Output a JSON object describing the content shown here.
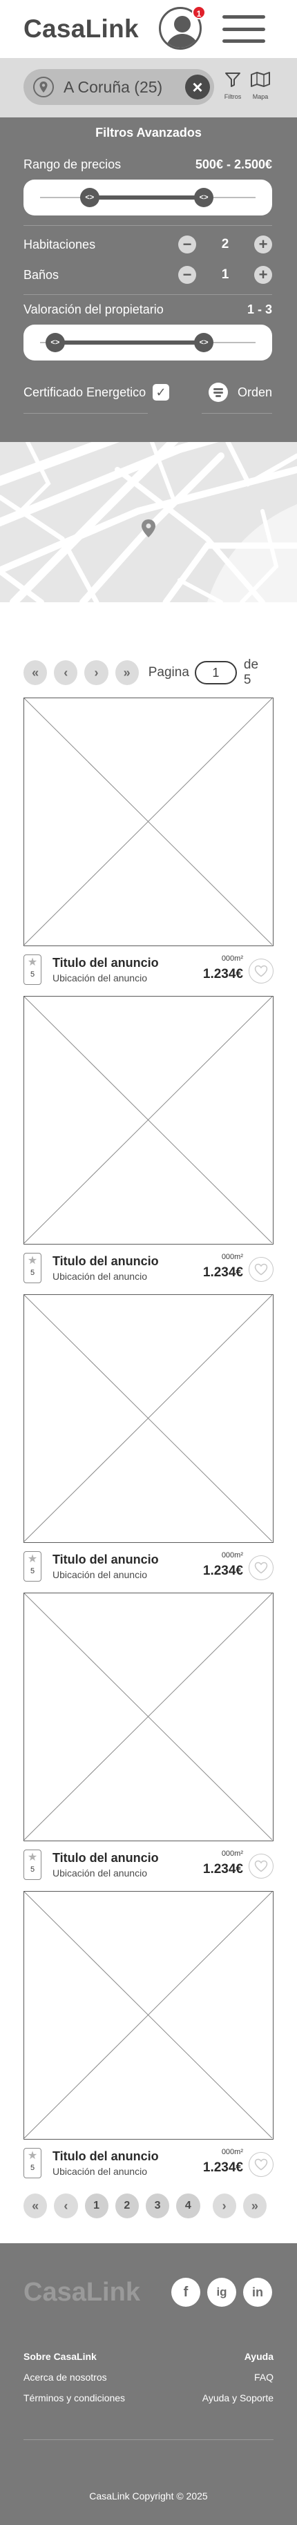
{
  "header": {
    "logo": "CasaLink",
    "notification_count": "1"
  },
  "search": {
    "location": "A Coruña (25)",
    "clear_label": "×",
    "filters_label": "Filtros",
    "map_label": "Mapa"
  },
  "filters": {
    "title": "Filtros Avanzados",
    "price_label": "Rango de precios",
    "price_value": "500€ - 2.500€",
    "price_range_fraction": [
      0.23,
      0.76
    ],
    "rooms_label": "Habitaciones",
    "rooms_value": "2",
    "baths_label": "Baños",
    "baths_value": "1",
    "rating_label": "Valoración del propietario",
    "rating_value": "1 - 3",
    "rating_range_fraction": [
      0.07,
      0.76
    ],
    "certificate_label": "Certificado Energetico",
    "certificate_checked": true,
    "order_label": "Orden",
    "minus": "−",
    "plus": "+",
    "check_mark": "✓"
  },
  "pagination": {
    "page_label": "Pagina",
    "current_page": "1",
    "total_label": "de 5",
    "pages": [
      "1",
      "2",
      "3",
      "4"
    ]
  },
  "listings": [
    {
      "title": "Titulo del anuncio",
      "location": "Ubicación del anuncio",
      "area": "000m²",
      "price": "1.234€",
      "rating": "5"
    },
    {
      "title": "Titulo del anuncio",
      "location": "Ubicación del anuncio",
      "area": "000m²",
      "price": "1.234€",
      "rating": "5"
    },
    {
      "title": "Titulo del anuncio",
      "location": "Ubicación del anuncio",
      "area": "000m²",
      "price": "1.234€",
      "rating": "5"
    },
    {
      "title": "Titulo del anuncio",
      "location": "Ubicación del anuncio",
      "area": "000m²",
      "price": "1.234€",
      "rating": "5"
    },
    {
      "title": "Titulo del anuncio",
      "location": "Ubicación del anuncio",
      "area": "000m²",
      "price": "1.234€",
      "rating": "5"
    }
  ],
  "footer": {
    "logo": "CasaLink",
    "facebook": "f",
    "instagram": "ig",
    "linkedin": "in",
    "about_heading": "Sobre CasaLink",
    "about_us": "Acerca de nosotros",
    "terms": "Términos y condiciones",
    "help_heading": "Ayuda",
    "faq": "FAQ",
    "support": "Ayuda y Soporte",
    "copyright": "CasaLink Copyright © 2025"
  },
  "colors": {
    "header_bg": "#ffffff",
    "search_bg": "#dcdcdc",
    "filters_bg": "#797979",
    "footer_bg": "#797979",
    "badge": "#e0202a"
  }
}
